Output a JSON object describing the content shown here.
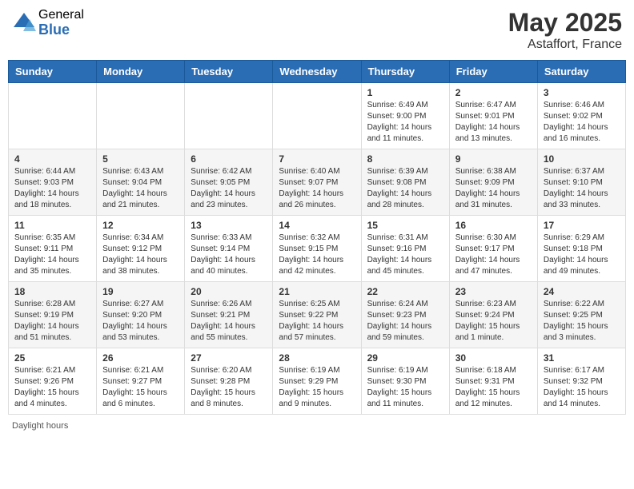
{
  "header": {
    "logo_general": "General",
    "logo_blue": "Blue",
    "month_title": "May 2025",
    "location": "Astaffort, France"
  },
  "calendar": {
    "weekdays": [
      "Sunday",
      "Monday",
      "Tuesday",
      "Wednesday",
      "Thursday",
      "Friday",
      "Saturday"
    ],
    "weeks": [
      [
        {
          "day": "",
          "info": ""
        },
        {
          "day": "",
          "info": ""
        },
        {
          "day": "",
          "info": ""
        },
        {
          "day": "",
          "info": ""
        },
        {
          "day": "1",
          "info": "Sunrise: 6:49 AM\nSunset: 9:00 PM\nDaylight: 14 hours and 11 minutes."
        },
        {
          "day": "2",
          "info": "Sunrise: 6:47 AM\nSunset: 9:01 PM\nDaylight: 14 hours and 13 minutes."
        },
        {
          "day": "3",
          "info": "Sunrise: 6:46 AM\nSunset: 9:02 PM\nDaylight: 14 hours and 16 minutes."
        }
      ],
      [
        {
          "day": "4",
          "info": "Sunrise: 6:44 AM\nSunset: 9:03 PM\nDaylight: 14 hours and 18 minutes."
        },
        {
          "day": "5",
          "info": "Sunrise: 6:43 AM\nSunset: 9:04 PM\nDaylight: 14 hours and 21 minutes."
        },
        {
          "day": "6",
          "info": "Sunrise: 6:42 AM\nSunset: 9:05 PM\nDaylight: 14 hours and 23 minutes."
        },
        {
          "day": "7",
          "info": "Sunrise: 6:40 AM\nSunset: 9:07 PM\nDaylight: 14 hours and 26 minutes."
        },
        {
          "day": "8",
          "info": "Sunrise: 6:39 AM\nSunset: 9:08 PM\nDaylight: 14 hours and 28 minutes."
        },
        {
          "day": "9",
          "info": "Sunrise: 6:38 AM\nSunset: 9:09 PM\nDaylight: 14 hours and 31 minutes."
        },
        {
          "day": "10",
          "info": "Sunrise: 6:37 AM\nSunset: 9:10 PM\nDaylight: 14 hours and 33 minutes."
        }
      ],
      [
        {
          "day": "11",
          "info": "Sunrise: 6:35 AM\nSunset: 9:11 PM\nDaylight: 14 hours and 35 minutes."
        },
        {
          "day": "12",
          "info": "Sunrise: 6:34 AM\nSunset: 9:12 PM\nDaylight: 14 hours and 38 minutes."
        },
        {
          "day": "13",
          "info": "Sunrise: 6:33 AM\nSunset: 9:14 PM\nDaylight: 14 hours and 40 minutes."
        },
        {
          "day": "14",
          "info": "Sunrise: 6:32 AM\nSunset: 9:15 PM\nDaylight: 14 hours and 42 minutes."
        },
        {
          "day": "15",
          "info": "Sunrise: 6:31 AM\nSunset: 9:16 PM\nDaylight: 14 hours and 45 minutes."
        },
        {
          "day": "16",
          "info": "Sunrise: 6:30 AM\nSunset: 9:17 PM\nDaylight: 14 hours and 47 minutes."
        },
        {
          "day": "17",
          "info": "Sunrise: 6:29 AM\nSunset: 9:18 PM\nDaylight: 14 hours and 49 minutes."
        }
      ],
      [
        {
          "day": "18",
          "info": "Sunrise: 6:28 AM\nSunset: 9:19 PM\nDaylight: 14 hours and 51 minutes."
        },
        {
          "day": "19",
          "info": "Sunrise: 6:27 AM\nSunset: 9:20 PM\nDaylight: 14 hours and 53 minutes."
        },
        {
          "day": "20",
          "info": "Sunrise: 6:26 AM\nSunset: 9:21 PM\nDaylight: 14 hours and 55 minutes."
        },
        {
          "day": "21",
          "info": "Sunrise: 6:25 AM\nSunset: 9:22 PM\nDaylight: 14 hours and 57 minutes."
        },
        {
          "day": "22",
          "info": "Sunrise: 6:24 AM\nSunset: 9:23 PM\nDaylight: 14 hours and 59 minutes."
        },
        {
          "day": "23",
          "info": "Sunrise: 6:23 AM\nSunset: 9:24 PM\nDaylight: 15 hours and 1 minute."
        },
        {
          "day": "24",
          "info": "Sunrise: 6:22 AM\nSunset: 9:25 PM\nDaylight: 15 hours and 3 minutes."
        }
      ],
      [
        {
          "day": "25",
          "info": "Sunrise: 6:21 AM\nSunset: 9:26 PM\nDaylight: 15 hours and 4 minutes."
        },
        {
          "day": "26",
          "info": "Sunrise: 6:21 AM\nSunset: 9:27 PM\nDaylight: 15 hours and 6 minutes."
        },
        {
          "day": "27",
          "info": "Sunrise: 6:20 AM\nSunset: 9:28 PM\nDaylight: 15 hours and 8 minutes."
        },
        {
          "day": "28",
          "info": "Sunrise: 6:19 AM\nSunset: 9:29 PM\nDaylight: 15 hours and 9 minutes."
        },
        {
          "day": "29",
          "info": "Sunrise: 6:19 AM\nSunset: 9:30 PM\nDaylight: 15 hours and 11 minutes."
        },
        {
          "day": "30",
          "info": "Sunrise: 6:18 AM\nSunset: 9:31 PM\nDaylight: 15 hours and 12 minutes."
        },
        {
          "day": "31",
          "info": "Sunrise: 6:17 AM\nSunset: 9:32 PM\nDaylight: 15 hours and 14 minutes."
        }
      ]
    ]
  },
  "footer": {
    "note": "Daylight hours"
  }
}
